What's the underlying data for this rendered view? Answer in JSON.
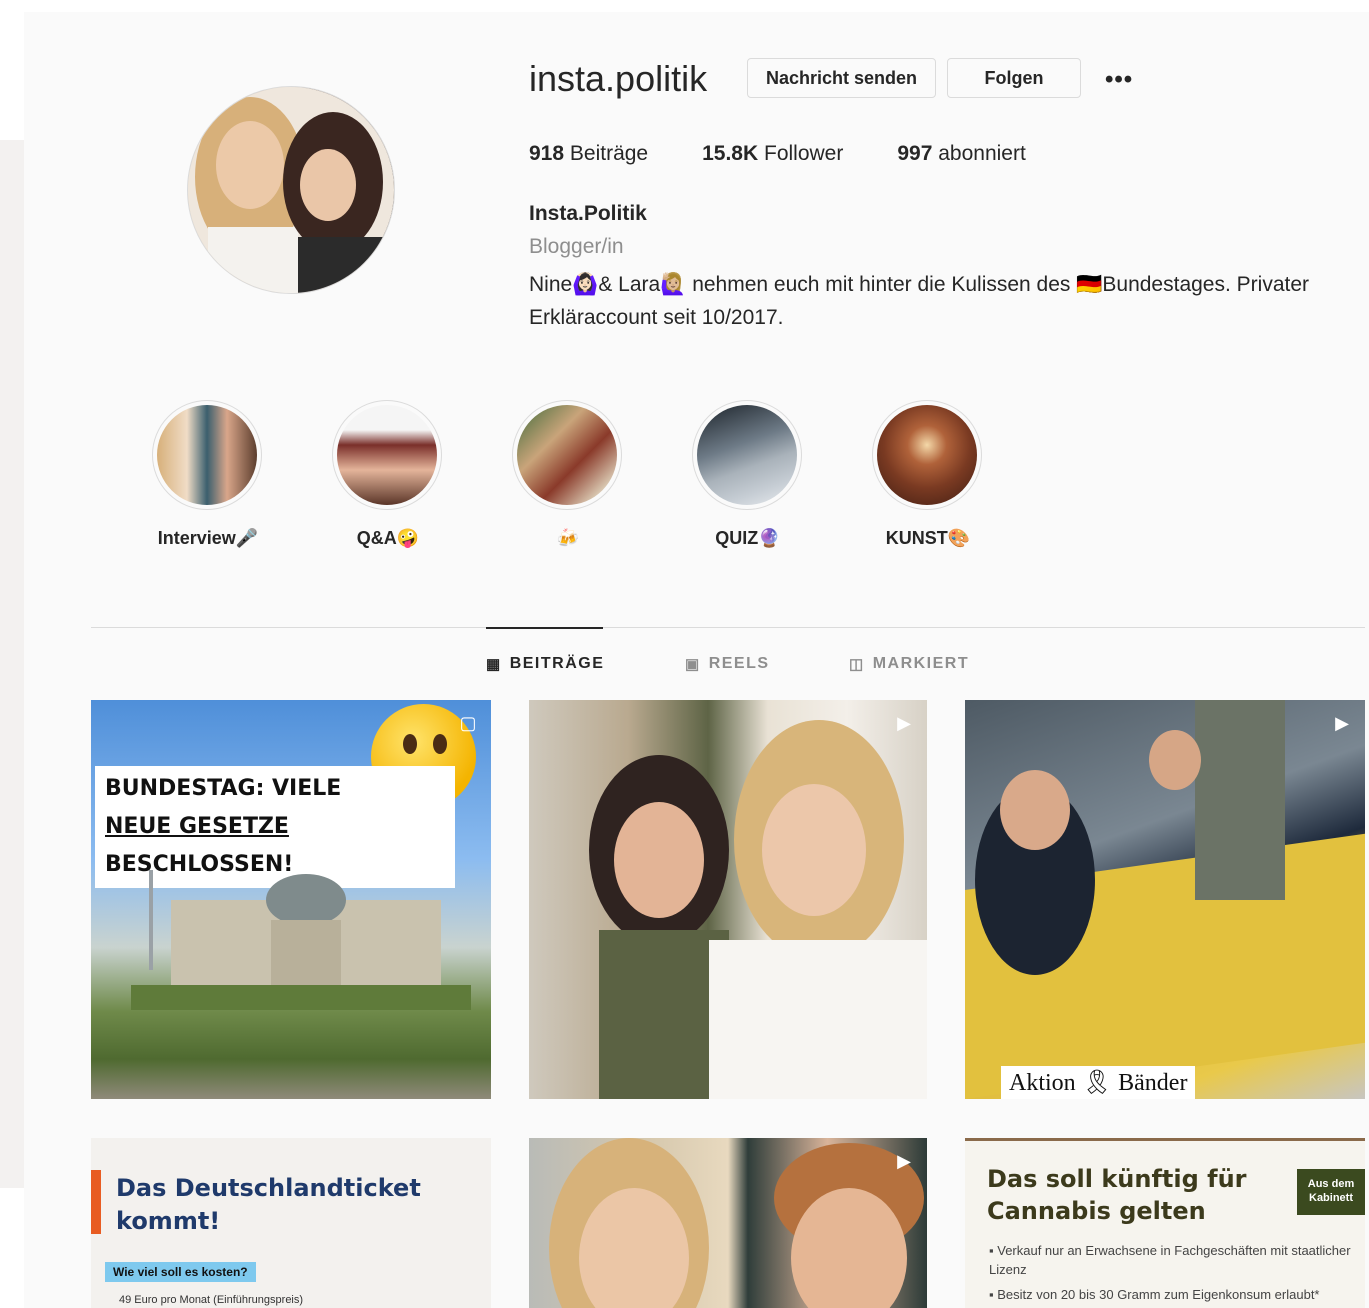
{
  "profile": {
    "username": "insta.politik",
    "message_button": "Nachricht senden",
    "follow_button": "Folgen",
    "more_icon": "•••",
    "stats": {
      "posts_count": "918",
      "posts_label": "Beiträge",
      "followers_count": "15.8K",
      "followers_label": "Follower",
      "following_count": "997",
      "following_label": "abonniert"
    },
    "full_name": "Insta.Politik",
    "category": "Blogger/in",
    "bio": "Nine🙆🏻‍♀️& Lara🙋🏼‍♀️ nehmen euch mit hinter die Kulissen des 🇩🇪Bundestages. Privater Erkläraccount seit 10/2017."
  },
  "highlights": [
    {
      "label": "Interview🎤"
    },
    {
      "label": "Q&A🤪"
    },
    {
      "label": "🍻"
    },
    {
      "label": "QUIZ🔮"
    },
    {
      "label": "KUNST🎨"
    }
  ],
  "tabs": {
    "posts": "BEITRÄGE",
    "reels": "REELS",
    "tagged": "MARKIERT"
  },
  "posts": {
    "p1": {
      "line1": "BUNDESTAG: VIELE",
      "line2_a": "NEUE GESETZE",
      "line2_b": " BESCHLOSSEN!"
    },
    "p3": {
      "caption": "Aktion 🎗 Bänder"
    },
    "p4": {
      "title": "Das Deutschlandticket kommt!",
      "badge": "Wie viel soll es kosten?",
      "item": "49 Euro pro Monat (Einführungspreis)"
    },
    "p6": {
      "title": "Das soll künftig für Cannabis gelten",
      "tag": "Aus dem Kabinett",
      "item1": "Verkauf nur an Erwachsene in Fachgeschäften mit staatlicher Lizenz",
      "item2": "Besitz von 20 bis 30 Gramm zum Eigenkonsum erlaubt*"
    }
  },
  "colors": {
    "accent": "#262626",
    "muted": "#8e8e8e",
    "border": "#dbdbdb"
  }
}
